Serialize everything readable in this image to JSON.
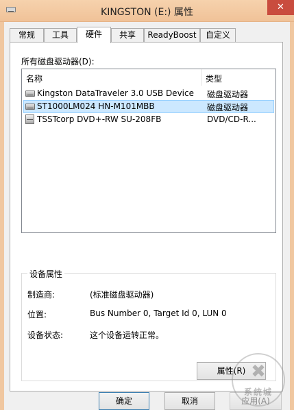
{
  "window": {
    "title": "KINGSTON (E:) 属性",
    "close_glyph": "✕"
  },
  "tabs": [
    {
      "label": "常规"
    },
    {
      "label": "工具"
    },
    {
      "label": "硬件"
    },
    {
      "label": "共享"
    },
    {
      "label": "ReadyBoost"
    },
    {
      "label": "自定义"
    }
  ],
  "active_tab": "硬件",
  "hardware": {
    "list_label": "所有磁盘驱动器(D):",
    "columns": {
      "name": "名称",
      "type": "类型"
    },
    "rows": [
      {
        "name": "Kingston DataTraveler 3.0 USB Device",
        "type": "磁盘驱动器",
        "icon": "disk-drive-icon"
      },
      {
        "name": "ST1000LM024 HN-M101MBB",
        "type": "磁盘驱动器",
        "icon": "disk-drive-icon",
        "selected": true
      },
      {
        "name": "TSSTcorp DVD+-RW SU-208FB",
        "type": "DVD/CD-R...",
        "icon": "dvd-drive-icon"
      }
    ]
  },
  "properties": {
    "group_title": "设备属性",
    "manufacturer_label": "制造商:",
    "manufacturer_value": "(标准磁盘驱动器)",
    "location_label": "位置:",
    "location_value": "Bus Number 0, Target Id 0, LUN 0",
    "status_label": "设备状态:",
    "status_value": "这个设备运转正常。",
    "properties_button": "属性(R)"
  },
  "buttons": {
    "ok": "确定",
    "cancel": "取消",
    "apply": "应用(A)"
  },
  "watermark": {
    "mark": "✖",
    "text": "系统城"
  }
}
